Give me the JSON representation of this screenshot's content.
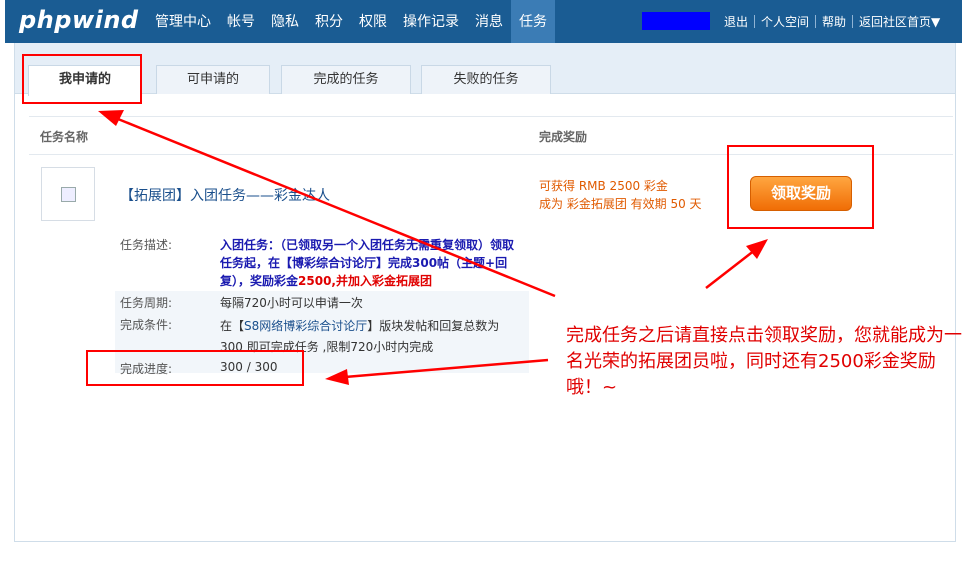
{
  "header": {
    "logo": "phpwind",
    "nav": [
      "管理中心",
      "帐号",
      "隐私",
      "积分",
      "权限",
      "操作记录",
      "消息",
      "任务"
    ],
    "active_nav": "任务",
    "links": [
      "退出",
      "个人空间",
      "帮助",
      "返回社区首页▼"
    ]
  },
  "tabs": [
    "我申请的",
    "可申请的",
    "完成的任务",
    "失败的任务"
  ],
  "active_tab": "我申请的",
  "columns": {
    "name": "任务名称",
    "reward": "完成奖励"
  },
  "task": {
    "title": "【拓展团】入团任务——彩金达人",
    "reward_line1": "可获得 RMB 2500 彩金",
    "reward_line2": "成为 彩金拓展团 有效期 50 天",
    "claim_button": "领取奖励",
    "desc_label": "任务描述:",
    "desc_part1": "入团任务：（已领取另一个入团任务无需重复领取）领取任务起，在【博彩综合讨论厅】完成300帖（主题+回复），奖励彩金",
    "desc_part2": "2500,并加入彩金拓展团",
    "period_label": "任务周期:",
    "period_value": "每隔720小时可以申请一次",
    "cond_label": "完成条件:",
    "cond_prefix": "在【",
    "cond_link": "S8网络博彩综合讨论厅",
    "cond_suffix": "】版块发帖和回复总数为 300 即可完成任务 ,限制720小时内完成",
    "progress_label": "完成进度:",
    "progress_value": "300 / 300"
  },
  "annotation": "完成任务之后请直接点击领取奖励，您就能成为一名光荣的拓展团员啦，同时还有2500彩金奖励哦！~",
  "colors": {
    "header_bg": "#1a5c93",
    "annotation_red": "#ff0000",
    "button_orange": "#f27a10"
  }
}
